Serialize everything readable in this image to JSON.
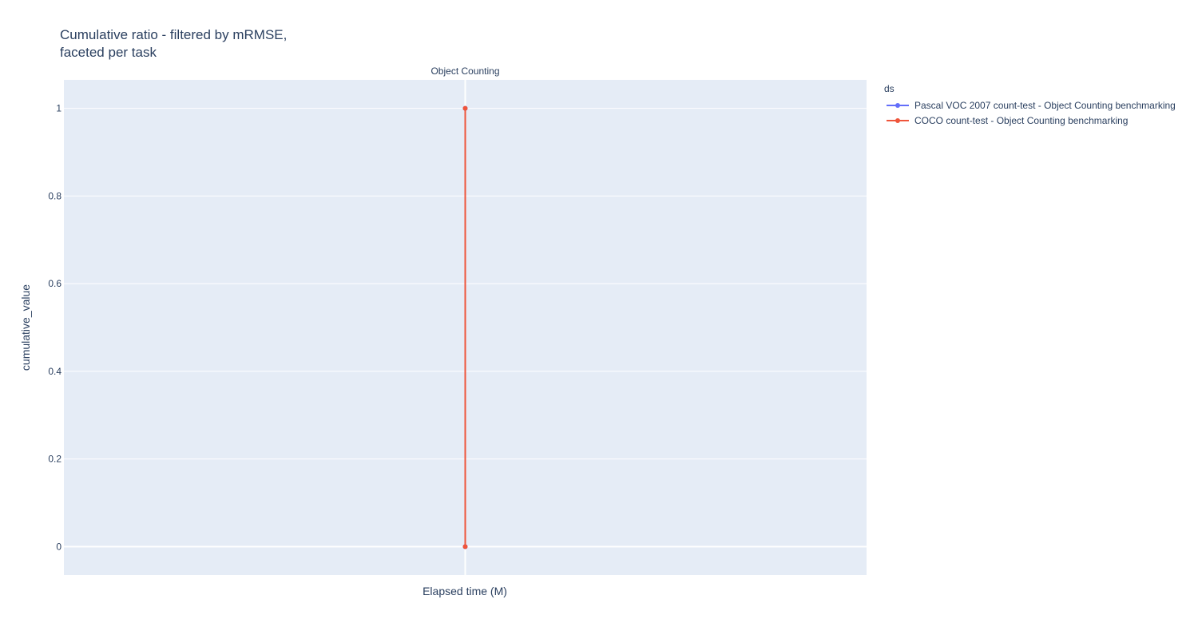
{
  "title": {
    "line1": "Cumulative ratio - filtered by mRMSE,",
    "line2": "faceted per task"
  },
  "colors": {
    "plot_bg": "#e5ecf6",
    "grid": "#ffffff",
    "text": "#2a3f5f"
  },
  "chart_data": {
    "type": "line",
    "facet": "Object Counting",
    "xlabel": "Elapsed time (M)",
    "ylabel": "cumulative_value",
    "ylim": [
      -0.065,
      1.065
    ],
    "yticks": [
      "0",
      "0.2",
      "0.4",
      "0.6",
      "0.8",
      "1"
    ],
    "ytick_values": [
      0,
      0.2,
      0.4,
      0.6,
      0.8,
      1
    ],
    "grid": true,
    "legend_title": "ds",
    "legend_position": "top-right, outside plot",
    "series": [
      {
        "name": "Pascal VOC 2007 count-test - Object Counting benchmarking",
        "color": "#636efa",
        "x": [
          0,
          0
        ],
        "y": [
          0,
          1
        ]
      },
      {
        "name": "COCO count-test - Object Counting benchmarking",
        "color": "#ef553b",
        "x": [
          0,
          0
        ],
        "y": [
          0,
          1
        ]
      }
    ]
  }
}
